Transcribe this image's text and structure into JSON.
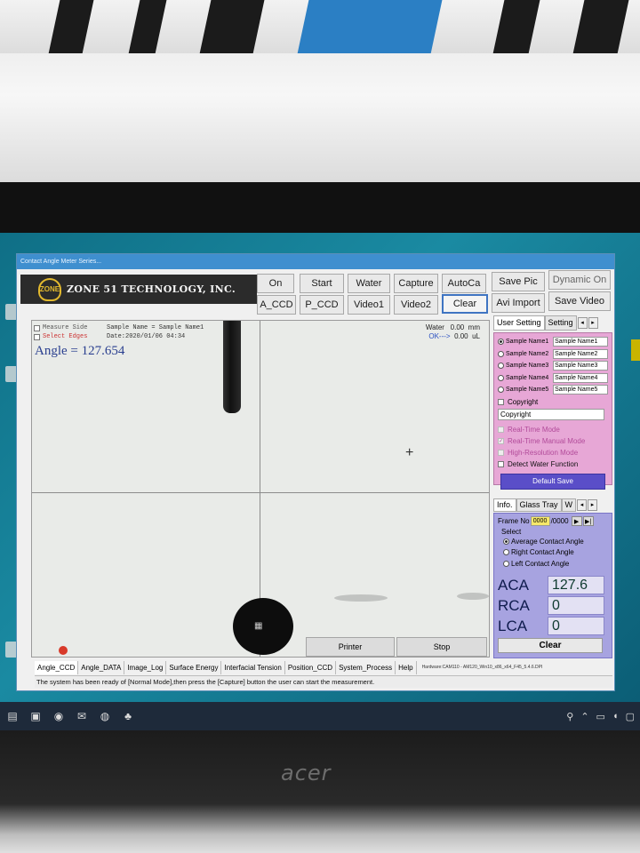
{
  "app": {
    "title": "Contact Angle Meter Series...",
    "brand": "ZONE 51 TECHNOLOGY, INC.",
    "logo_mark": "ZONE"
  },
  "toolbar": {
    "row1": [
      "On",
      "Start",
      "Water",
      "Capture",
      "AutoCa",
      "Save Pic",
      "Dynamic On"
    ],
    "row2": [
      "A_CCD",
      "P_CCD",
      "Video1",
      "Video2",
      "Clear",
      "Avi Import",
      "Save Video"
    ]
  },
  "viewer": {
    "measure_side": "Measure Side",
    "select_edges": "Select Edges",
    "sample_name": "Sample Name = Sample Name1",
    "date": "Date:2020/01/06 04:34",
    "angle_text": "Angle = 127.654",
    "water_label": "Water",
    "water_value": "0.00",
    "water_unit": "mm",
    "ok_label": "OK--->",
    "ok_value": "0.00",
    "ok_unit": "uL",
    "printer_label": "Printer",
    "stop_label": "Stop"
  },
  "user_panel": {
    "tabs": [
      "User Setting",
      "Setting"
    ],
    "samples": [
      {
        "label": "Sample Name1",
        "value": "Sample Name1",
        "selected": true
      },
      {
        "label": "Sample Name2",
        "value": "Sample Name2",
        "selected": false
      },
      {
        "label": "Sample Name3",
        "value": "Sample Name3",
        "selected": false
      },
      {
        "label": "Sample Name4",
        "value": "Sample Name4",
        "selected": false
      },
      {
        "label": "Sample Name5",
        "value": "Sample Name5",
        "selected": false
      }
    ],
    "copyright_check": "Copyright",
    "copyright_value": "Copyright",
    "modes": [
      "Real-Time Mode",
      "Real-Time Manual Mode",
      "High-Resolution Mode",
      "Detect Water Function"
    ],
    "default_save": "Default Save"
  },
  "info_panel": {
    "tabs": [
      "Info.",
      "Glass Tray",
      "W"
    ],
    "frame_label": "Frame No",
    "frame_value": "0000",
    "frame_total": "/0000",
    "select_label": "Select",
    "options": [
      "Average Contact Angle",
      "Right Contact Angle",
      "Left Contact Angle"
    ],
    "aca_label": "ACA",
    "aca_value": "127.6",
    "rca_label": "RCA",
    "rca_value": "0",
    "lca_label": "LCA",
    "lca_value": "0",
    "clear_label": "Clear"
  },
  "bottom_tabs": [
    "Angle_CCD",
    "Angle_DATA",
    "Image_Log",
    "Surface Energy",
    "Interfacial Tension",
    "Position_CCD",
    "System_Process",
    "Help"
  ],
  "hardware_info": "Hardware:CAM110 - AM120_Win10_x86_x64_F45_5.4.6.DPI",
  "status": "The system has been ready of [Normal Mode],then press the [Capture] button the user can start the measurement.",
  "laptop_brand": "acer",
  "colors": {
    "user_panel_bg": "#e7a7d6",
    "info_panel_bg": "#a7a3e0",
    "angle_text": "#2a3f8f",
    "default_save_bg": "#5a4ec8"
  }
}
